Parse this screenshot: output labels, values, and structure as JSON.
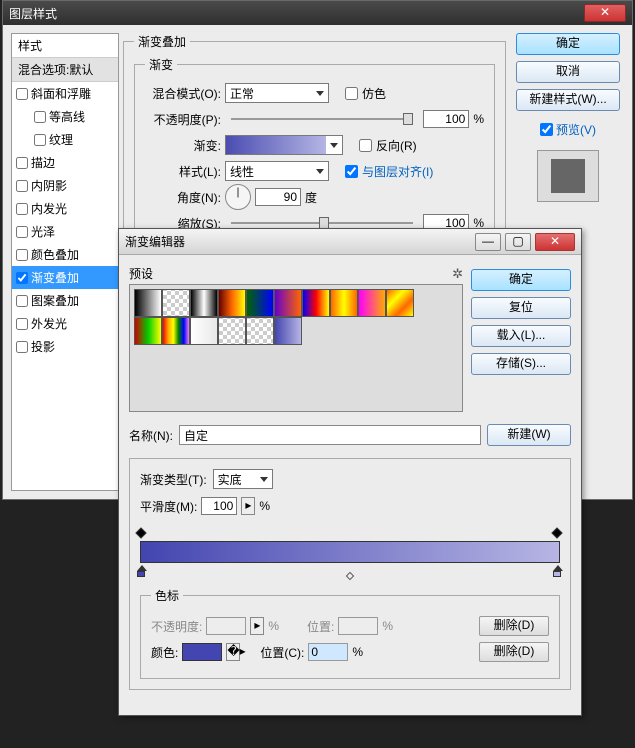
{
  "main": {
    "title": "图层样式",
    "styles_header": "样式",
    "blend_default": "混合选项:默认",
    "items": [
      {
        "label": "斜面和浮雕",
        "checked": false
      },
      {
        "label": "等高线",
        "checked": false,
        "indent": true
      },
      {
        "label": "纹理",
        "checked": false,
        "indent": true
      },
      {
        "label": "描边",
        "checked": false
      },
      {
        "label": "内阴影",
        "checked": false
      },
      {
        "label": "内发光",
        "checked": false
      },
      {
        "label": "光泽",
        "checked": false
      },
      {
        "label": "颜色叠加",
        "checked": false
      },
      {
        "label": "渐变叠加",
        "checked": true,
        "selected": true
      },
      {
        "label": "图案叠加",
        "checked": false
      },
      {
        "label": "外发光",
        "checked": false
      },
      {
        "label": "投影",
        "checked": false
      }
    ],
    "section_title": "渐变叠加",
    "gradient_legend": "渐变",
    "blend_mode_label": "混合模式(O):",
    "blend_mode_value": "正常",
    "dither_label": "仿色",
    "opacity_label": "不透明度(P):",
    "opacity_value": "100",
    "percent": "%",
    "gradient_label": "渐变:",
    "reverse_label": "反向(R)",
    "style_label": "样式(L):",
    "style_value": "线性",
    "align_label": "与图层对齐(I)",
    "angle_label": "角度(N):",
    "angle_value": "90",
    "degree": "度",
    "scale_label": "缩放(S):",
    "scale_value": "100",
    "buttons": {
      "ok": "确定",
      "cancel": "取消",
      "newstyle": "新建样式(W)...",
      "preview": "预览(V)"
    }
  },
  "editor": {
    "title": "渐变编辑器",
    "presets_label": "预设",
    "buttons": {
      "ok": "确定",
      "reset": "复位",
      "load": "载入(L)...",
      "save": "存储(S)...",
      "new": "新建(W)",
      "delete": "删除(D)"
    },
    "name_label": "名称(N):",
    "name_value": "自定",
    "grad_type_label": "渐变类型(T):",
    "grad_type_value": "实底",
    "smoothness_label": "平滑度(M):",
    "smoothness_value": "100",
    "percent": "%",
    "stops_legend": "色标",
    "opacity_label": "不透明度:",
    "position_label": "位置:",
    "position_c_label": "位置(C):",
    "position_c_value": "0",
    "color_label": "颜色:",
    "swatches": [
      "linear-gradient(90deg,#000,#fff)",
      "repeating-conic-gradient(#ccc 0 25%,#fff 0 50%) 0/8px 8px",
      "linear-gradient(90deg,#000,#fff,#000)",
      "linear-gradient(90deg,#600,#f60,#ff0)",
      "linear-gradient(90deg,#060,#00f)",
      "linear-gradient(90deg,#60c,#f60)",
      "linear-gradient(90deg,#00f,#f00,#ff0)",
      "linear-gradient(90deg,#f60,#ff0,#f60)",
      "linear-gradient(90deg,#f0f,#fa0)",
      "linear-gradient(135deg,#f60,#ff0,#f60,#ff0)",
      "linear-gradient(90deg,#c00,#0c0,#ff0)",
      "linear-gradient(90deg,red,orange,yellow,green,blue,violet)",
      "linear-gradient(90deg,#fff,#e8e8e8)",
      "repeating-conic-gradient(#ccc 0 25%,#fff 0 50%) 0/8px 8px",
      "repeating-conic-gradient(#ccc 0 25%,#fff 0 50%) 0/8px 8px",
      "linear-gradient(90deg,#4345b0,#b7b5e4)"
    ]
  }
}
